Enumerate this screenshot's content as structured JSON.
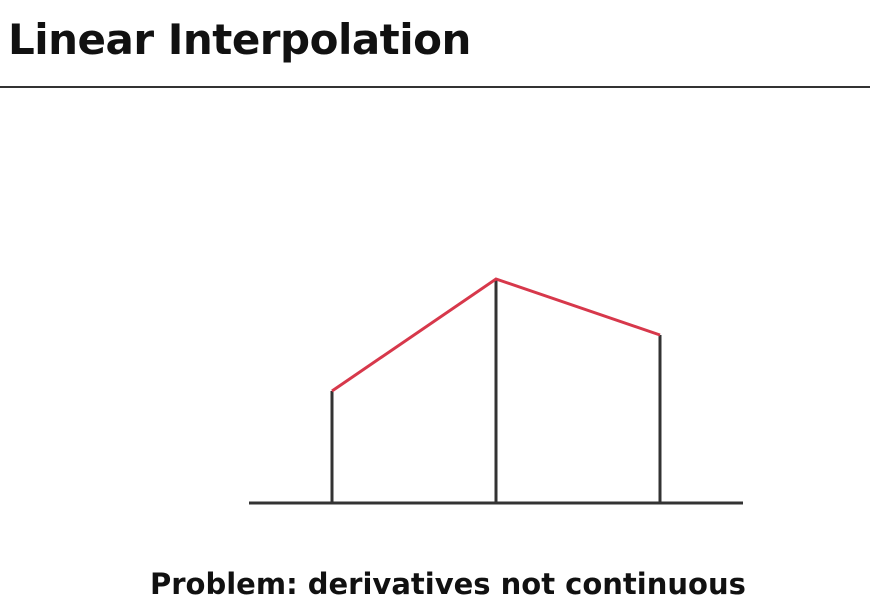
{
  "title": "Linear Interpolation",
  "caption": "Problem: derivatives not continuous",
  "colors": {
    "text": "#111111",
    "axis": "#333333",
    "interpolant": "#d7384b"
  },
  "diagram": {
    "samples": [
      {
        "index": 0,
        "value": 0.5
      },
      {
        "index": 1,
        "value": 1.0
      },
      {
        "index": 2,
        "value": 0.75
      }
    ]
  }
}
